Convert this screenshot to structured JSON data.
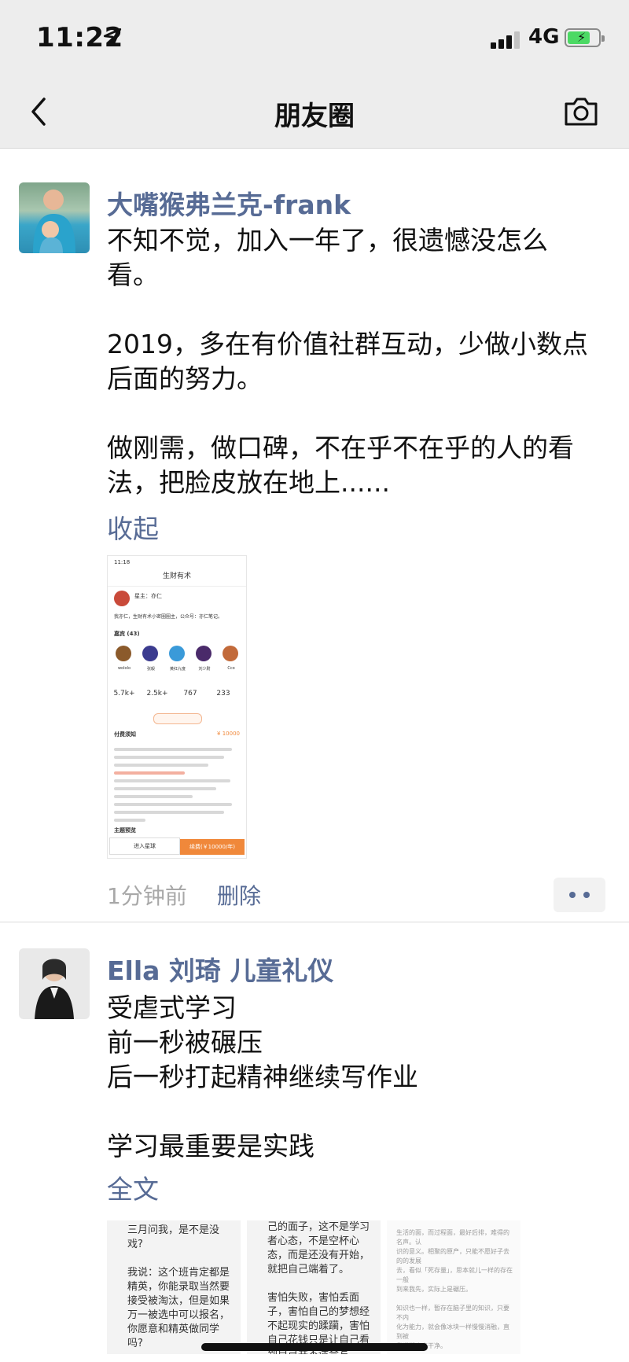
{
  "status_bar": {
    "time": "11:22",
    "network": "4G"
  },
  "nav": {
    "title": "朋友圈"
  },
  "posts": [
    {
      "author": "大嘴猴弗兰克-frank",
      "text": "不知不觉，加入一年了，很遗憾没怎么\n看。\n\n2019，多在有价值社群互动，少做小数点\n后面的努力。\n\n做刚需，做口碑，不在乎不在乎的人的看\n法，把脸皮放在地上......",
      "toggle_label": "收起",
      "shared_image": {
        "time": "11:18",
        "title": "生财有术",
        "owner_label": "星主：亦仁",
        "description": "我亦仁，生财有术小密圈圈主，公众号：亦仁笔记。",
        "guests_label": "嘉宾 (43)",
        "guests": [
          "wololo",
          "张毅",
          "黄红九度",
          "刘少尉",
          "Cco"
        ],
        "stats": [
          "5.7k+",
          "2.5k+",
          "767",
          "233"
        ],
        "notice_label": "付费须知",
        "price": "¥ 10000",
        "topics_label": "主题预览",
        "enter_label": "进入星球",
        "join_label": "续费(￥10000/年)"
      },
      "time_ago": "1分钟前",
      "delete_label": "删除"
    },
    {
      "author": "Ella 刘琦 儿童礼仪",
      "text": "受虐式学习\n前一秒被碾压\n后一秒打起精神继续写作业\n\n学习最重要是实践",
      "toggle_label": "全文",
      "images": [
        "三月问我，是不是没\n戏?\n\n我说：这个班肯定都是\n精英，你能录取当然要\n接受被淘汰，但是如果\n万一被选中可以报名，\n你愿意和精英做同学\n吗?",
        "己的面子，这不是学习\n者心态，不是空杯心\n态，而是还没有开始，\n就把自己端着了。\n\n害怕失败，害怕丢面\n子，害怕自己的梦想经\n不起现实的蹂躏，害怕\n自己花钱只是让自己看\n到自己并不适合写",
        "生活的面，而过程面，最好后排，难得的名声。认\n识的意义。相聚的原产，只能不愿好子去的的发展\n去，看似「死存量」，思本就儿一样的存在一般\n到来我先，实际上是碾压。\n\n知识也一样，暂存在脑子里的知识，只要不内\n化为能力，就会像冰块一样慢慢消融，直到被\n我们彻底忘干净。\n\n我像翠秋水老师在文章里写过的："
      ]
    }
  ]
}
